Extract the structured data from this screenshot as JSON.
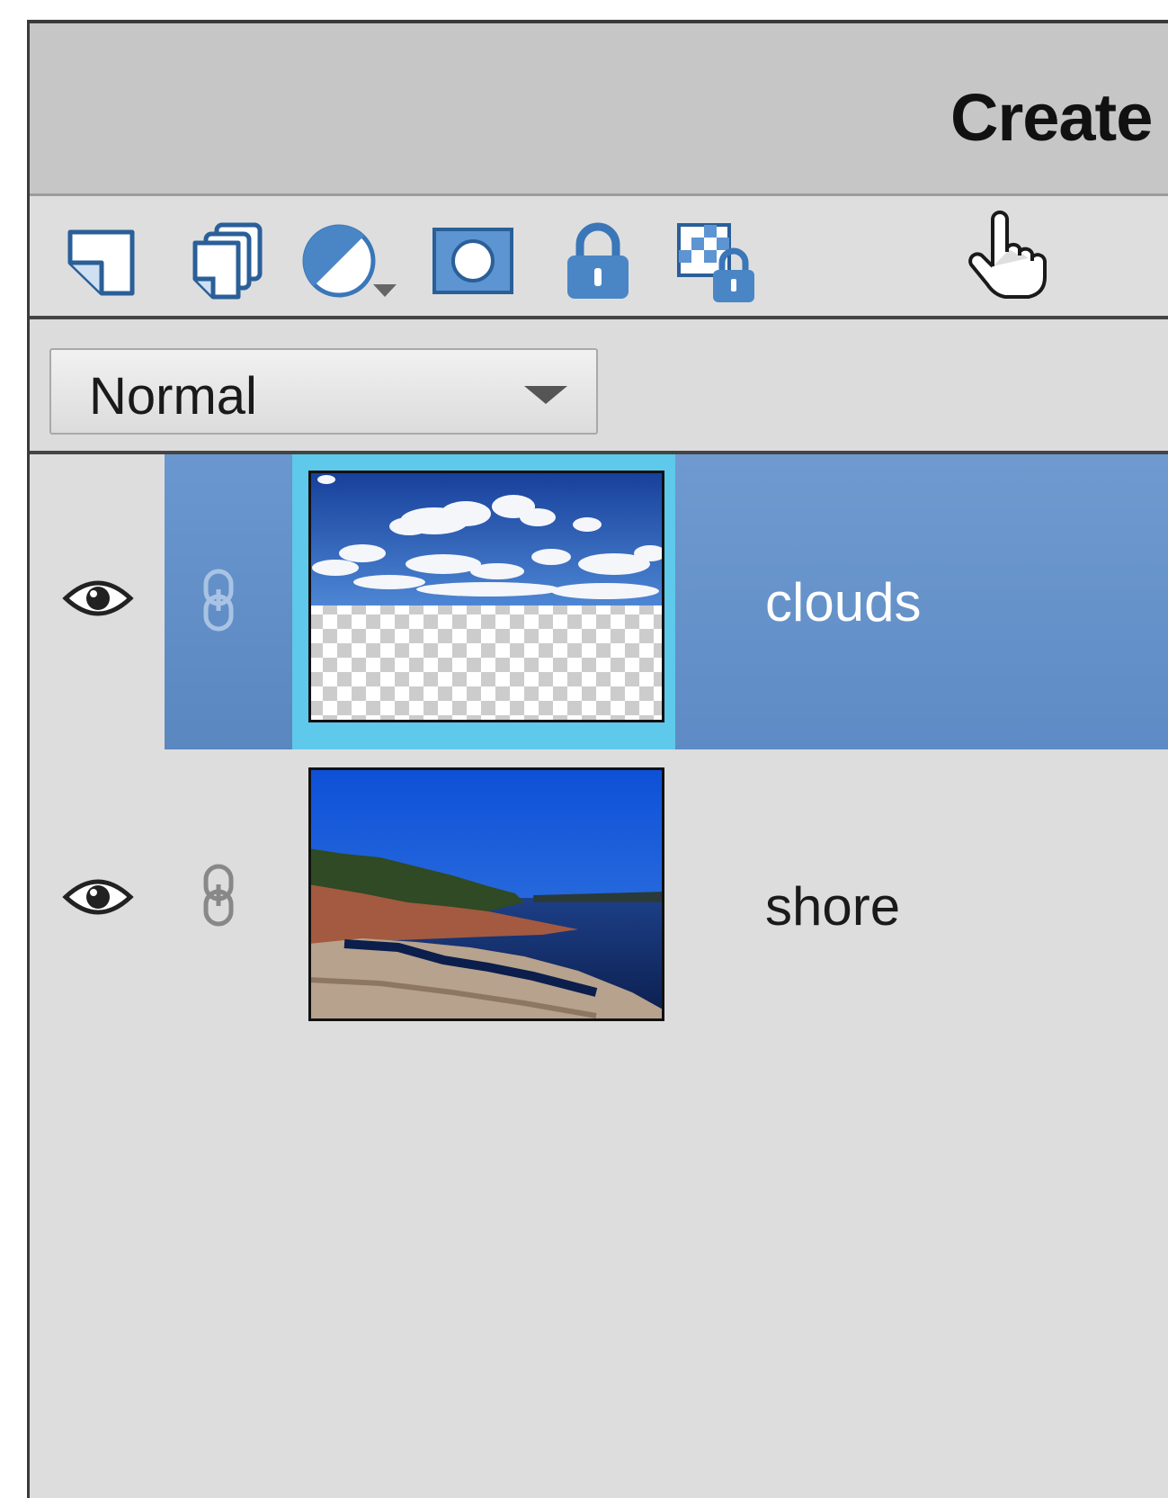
{
  "panel": {
    "header": {
      "title": "Create"
    },
    "toolbar": {
      "tools": [
        {
          "name": "new-layer-icon"
        },
        {
          "name": "new-group-icon"
        },
        {
          "name": "adjustment-layer-icon"
        },
        {
          "name": "layer-mask-icon"
        },
        {
          "name": "lock-all-icon"
        },
        {
          "name": "lock-transparent-icon"
        }
      ]
    },
    "blend_mode": {
      "selected": "Normal"
    },
    "layers": [
      {
        "name": "clouds",
        "visible": true,
        "selected": true
      },
      {
        "name": "shore",
        "visible": true,
        "selected": false
      }
    ]
  },
  "colors": {
    "selection": "#6a95cc",
    "thumbnail_highlight": "#5ec9ea",
    "panel_bg": "#dddddd",
    "icon_blue": "#4a86c5"
  }
}
